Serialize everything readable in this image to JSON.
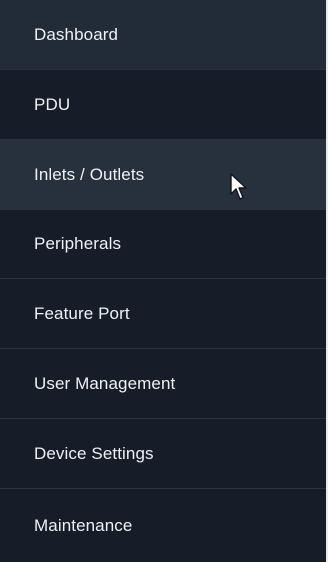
{
  "nav": {
    "items": [
      {
        "label": "Dashboard"
      },
      {
        "label": "PDU"
      },
      {
        "label": "Inlets / Outlets"
      },
      {
        "label": "Peripherals"
      },
      {
        "label": "Feature Port"
      },
      {
        "label": "User Management"
      },
      {
        "label": "Device Settings"
      },
      {
        "label": "Maintenance"
      }
    ]
  },
  "colors": {
    "background": "#161c28",
    "highlight": "#222b38",
    "hover": "#27303d",
    "text": "#eef1f5",
    "divider": "#2a3140"
  },
  "cursor": {
    "icon": "arrow-pointer-icon"
  }
}
